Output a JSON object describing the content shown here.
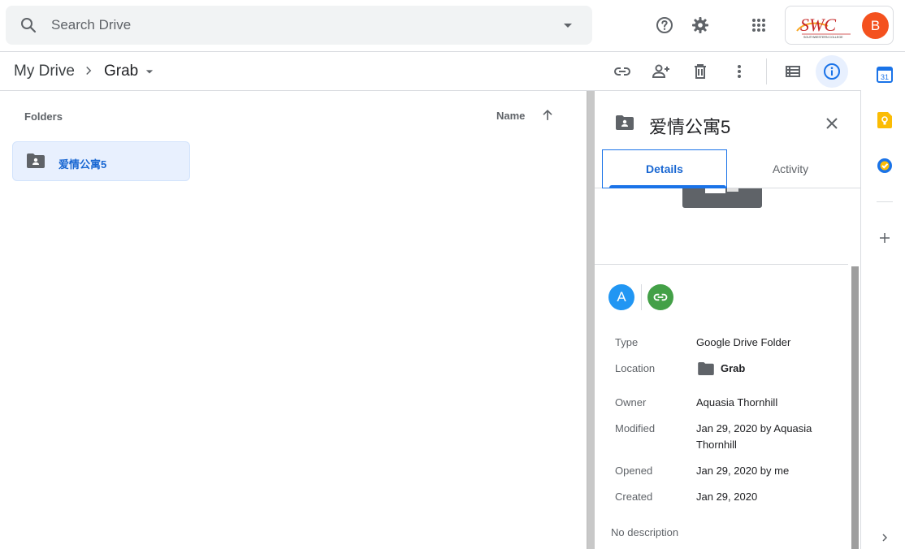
{
  "search": {
    "placeholder": "Search Drive"
  },
  "account": {
    "org_logo_text": "SWC",
    "org_logo_subtext": "SOUTHWESTERN COLLEGE",
    "avatar_initial": "B",
    "avatar_color": "#f4511e"
  },
  "topbar_icons": [
    "help-icon",
    "settings-icon",
    "apps-grid-icon"
  ],
  "breadcrumb": {
    "root": "My Drive",
    "current": "Grab"
  },
  "toolbar_icons": [
    "get-link-icon",
    "share-icon",
    "trash-icon",
    "more-vert-icon",
    "list-view-icon",
    "info-icon"
  ],
  "list": {
    "section_heading": "Folders",
    "sort_label": "Name",
    "folders": [
      {
        "name": "爱情公寓5"
      }
    ]
  },
  "details": {
    "title": "爱情公寓5",
    "tabs": {
      "details": "Details",
      "activity": "Activity"
    },
    "access_avatar": "A",
    "rows": {
      "type": {
        "label": "Type",
        "value": "Google Drive Folder"
      },
      "location": {
        "label": "Location",
        "value": "Grab"
      },
      "owner": {
        "label": "Owner",
        "value": "Aquasia Thornhill"
      },
      "modified": {
        "label": "Modified",
        "value": "Jan 29, 2020 by Aquasia Thornhill"
      },
      "opened": {
        "label": "Opened",
        "value": "Jan 29, 2020 by me"
      },
      "created": {
        "label": "Created",
        "value": "Jan 29, 2020"
      }
    },
    "description": "No description"
  },
  "side_rail": {
    "calendar_day": "31",
    "apps": [
      "calendar-icon",
      "keep-icon",
      "tasks-icon",
      "add-icon",
      "chevron-right-icon"
    ]
  },
  "colors": {
    "accent": "#1a73e8",
    "selected_bg": "#e8f0fe",
    "link_green": "#43a047",
    "access_blue": "#2196f3"
  }
}
